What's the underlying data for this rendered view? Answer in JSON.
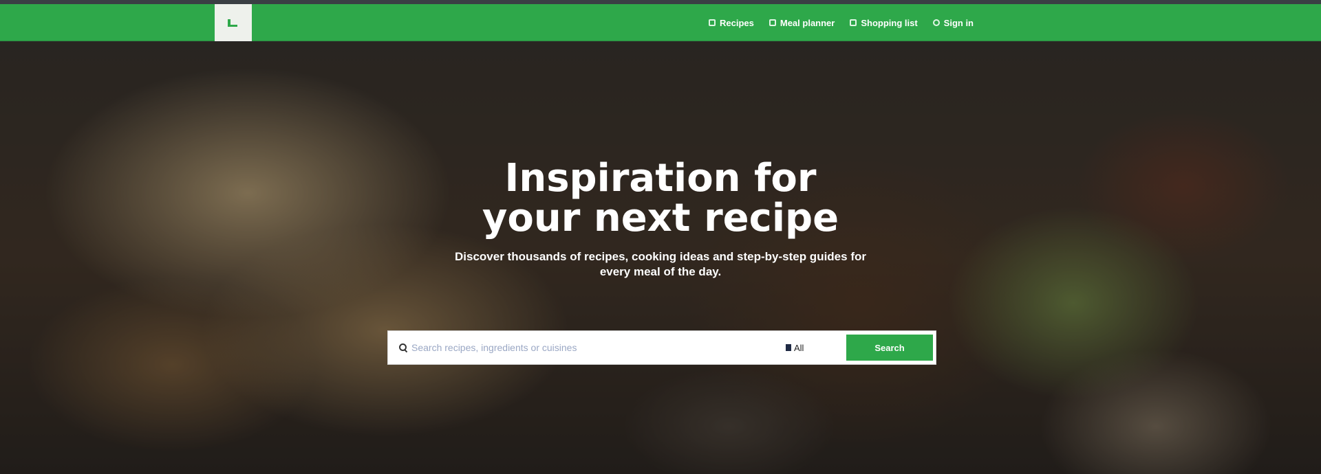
{
  "colors": {
    "brand_green": "#2ea84a",
    "logo_background": "#eef1ec",
    "top_strip": "#3a3f44"
  },
  "navbar": {
    "logo_icon": "leaf-logo-icon",
    "links": [
      {
        "label": "Recipes",
        "icon": "book-icon"
      },
      {
        "label": "Meal planner",
        "icon": "calendar-icon"
      },
      {
        "label": "Shopping list",
        "icon": "cart-icon"
      },
      {
        "label": "Sign in",
        "icon": "user-icon"
      }
    ]
  },
  "hero": {
    "title_line1": "Inspiration for",
    "title_line2": "your next recipe",
    "subtitle": "Discover thousands of recipes, cooking ideas and step-by-step guides for every meal of the day."
  },
  "search": {
    "placeholder": "Search recipes, ingredients or cuisines",
    "value": "",
    "filter_label": "All",
    "button_label": "Search"
  }
}
